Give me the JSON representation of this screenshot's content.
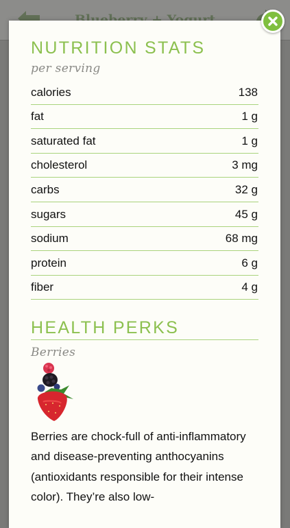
{
  "app_header": {
    "title": "Blueberry + Yogurt"
  },
  "nutrition": {
    "heading": "NUTRITION STATS",
    "subheading": "per serving",
    "rows": [
      {
        "label": "calories",
        "value": "138"
      },
      {
        "label": "fat",
        "value": "1 g"
      },
      {
        "label": "saturated fat",
        "value": "1 g"
      },
      {
        "label": "cholesterol",
        "value": "3 mg"
      },
      {
        "label": "carbs",
        "value": "32 g"
      },
      {
        "label": "sugars",
        "value": "45 g"
      },
      {
        "label": "sodium",
        "value": "68 mg"
      },
      {
        "label": "protein",
        "value": "6 g"
      },
      {
        "label": "fiber",
        "value": "4 g"
      }
    ]
  },
  "health_perks": {
    "heading": "HEALTH PERKS",
    "item_title": "Berries",
    "image_icon": "berries-image",
    "description": "Berries are chock-full of anti-inflammatory and disease-preventing anthocyanins (antioxidants responsible for their intense color). They’re also low-"
  },
  "icons": {
    "close": "close-icon",
    "back": "back-arrow-icon",
    "share": "share-icon"
  },
  "colors": {
    "accent_green": "#8cc04f",
    "rule_green": "#a9d37c",
    "close_button": "#7fbf3f",
    "modal_background": "#fdfdf8",
    "overlay": "#7a7a78"
  }
}
